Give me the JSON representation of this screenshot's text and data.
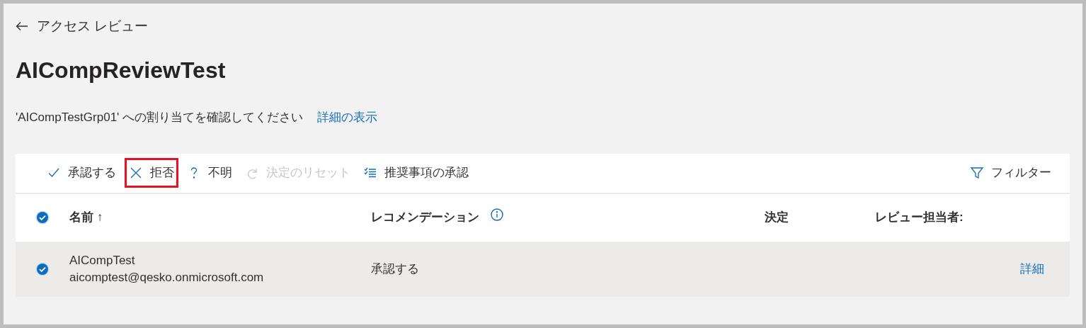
{
  "back_link": "アクセス レビュー",
  "title": "AICompReviewTest",
  "description": "'AICompTestGrp01' への割り当てを確認してください",
  "details_link": "詳細の表示",
  "toolbar": [
    {
      "kind": "check",
      "label": "承認する",
      "disabled": false,
      "highlighted": false
    },
    {
      "kind": "cross",
      "label": "拒否",
      "disabled": false,
      "highlighted": true
    },
    {
      "kind": "question",
      "label": "不明",
      "disabled": false,
      "highlighted": false
    },
    {
      "kind": "reset",
      "label": "決定のリセット",
      "disabled": true,
      "highlighted": false
    },
    {
      "kind": "list",
      "label": "推奨事項の承認",
      "disabled": false,
      "highlighted": false
    }
  ],
  "filter": "フィルター",
  "table": {
    "all_selected": true,
    "columns": [
      "名前 ↑",
      "レコメンデーション",
      "決定",
      "レビュー担当者:"
    ],
    "rows": [
      {
        "selected": true,
        "name": "AICompTest",
        "email": "aicomptest@qesko.onmicrosoft.com",
        "recommendation": "承認する",
        "action": "詳細"
      }
    ]
  }
}
